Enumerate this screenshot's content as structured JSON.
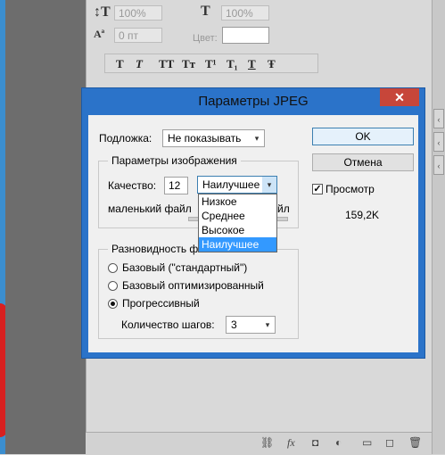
{
  "background": {
    "char_panel": {
      "vertical_scale": "100%",
      "horizontal_scale": "100%",
      "baseline_shift": "0 пт",
      "color_label": "Цвет:",
      "style_buttons": [
        "T",
        "T",
        "TT",
        "Tт",
        "T¹",
        "T₁",
        "T",
        "Ŧ"
      ]
    }
  },
  "dialog": {
    "title": "Параметры JPEG",
    "close_glyph": "✕",
    "matte_label": "Подложка:",
    "matte_value": "Не показывать",
    "image_options": {
      "title": "Параметры изображения",
      "quality_label": "Качество:",
      "quality_value": "12",
      "quality_dropdown_value": "Наилучшее",
      "small_file_label": "маленький файл",
      "large_file_fragment": "йл",
      "quality_options": [
        "Низкое",
        "Среднее",
        "Высокое",
        "Наилучшее"
      ],
      "selected_option_index": 3
    },
    "format": {
      "title": "Разновидность ф",
      "options": [
        "Базовый (\"стандартный\")",
        "Базовый оптимизированный",
        "Прогрессивный"
      ],
      "selected_index": 2,
      "scans_label": "Количество шагов:",
      "scans_value": "3"
    },
    "ok_label": "OK",
    "cancel_label": "Отмена",
    "preview_label": "Просмотр",
    "preview_checked": true,
    "file_size": "159,2K"
  }
}
